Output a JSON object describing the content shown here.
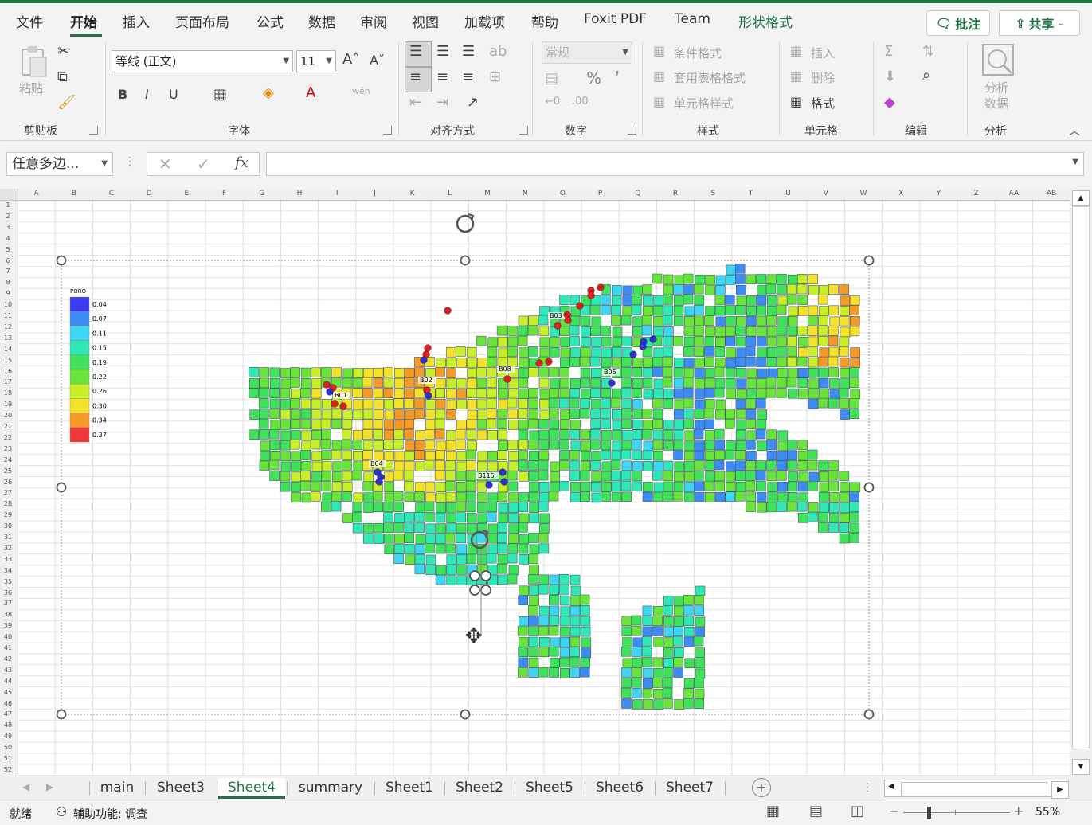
{
  "menu": {
    "tabs": [
      "文件",
      "开始",
      "插入",
      "页面布局",
      "公式",
      "数据",
      "审阅",
      "视图",
      "加载项",
      "帮助",
      "Foxit PDF",
      "Team",
      "形状格式"
    ],
    "comments": "批注",
    "share": "共享"
  },
  "ribbon": {
    "clipboard": {
      "paste": "粘贴",
      "label": "剪贴板"
    },
    "font": {
      "name": "等线 (正文)",
      "size": "11",
      "label": "字体",
      "bold": "B",
      "italic": "I",
      "underline": "U"
    },
    "align": {
      "label": "对齐方式"
    },
    "number": {
      "format": "常规",
      "label": "数字",
      "percent": "%"
    },
    "styles": {
      "cond": "条件格式",
      "table": "套用表格格式",
      "cell": "单元格样式",
      "label": "样式"
    },
    "cells": {
      "insert": "插入",
      "delete": "删除",
      "format": "格式",
      "label": "单元格"
    },
    "edit": {
      "label": "编辑"
    },
    "analysis": {
      "btn": "分析\n数据",
      "label": "分析"
    }
  },
  "formula": {
    "namebox": "任意多边...",
    "fx": "fx",
    "value": ""
  },
  "grid": {
    "columns": [
      "A",
      "B",
      "C",
      "D",
      "E",
      "F",
      "G",
      "H",
      "I",
      "J",
      "K",
      "L",
      "M",
      "N",
      "O",
      "P",
      "Q",
      "R",
      "S",
      "T",
      "U",
      "V",
      "W",
      "X",
      "Y",
      "Z",
      "AA",
      "AB"
    ],
    "rows": 52
  },
  "legend": {
    "title": "PORO",
    "values": [
      "0.04",
      "0.07",
      "0.11",
      "0.15",
      "0.19",
      "0.22",
      "0.26",
      "0.30",
      "0.34",
      "0.37"
    ],
    "colors": [
      "#3b3bf0",
      "#3d8cf5",
      "#3fd6f3",
      "#2fe8b5",
      "#3fe25a",
      "#68e43a",
      "#c8ef2a",
      "#f4e22a",
      "#f59a26",
      "#f03838"
    ]
  },
  "wells": [
    "B01",
    "B02",
    "B03",
    "B04",
    "B05",
    "B08",
    "B115"
  ],
  "sheets": [
    "main",
    "Sheet3",
    "Sheet4",
    "summary",
    "Sheet1",
    "Sheet2",
    "Sheet5",
    "Sheet6",
    "Sheet7"
  ],
  "active_sheet": "Sheet4",
  "status": {
    "ready": "就绪",
    "accessibility": "辅助功能: 调查",
    "zoom": "55%"
  }
}
